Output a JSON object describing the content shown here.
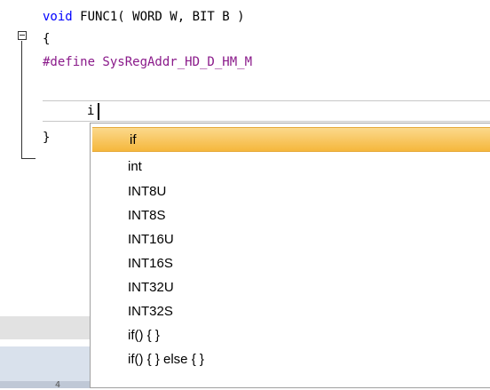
{
  "code": {
    "line1": {
      "kw": "void",
      "rest": " FUNC1( WORD W, BIT B )"
    },
    "line2": "{",
    "line3": "#define SysRegAddr_HD_D_HM_M",
    "typed": "i",
    "line5": "}"
  },
  "autocomplete": {
    "items": [
      {
        "label": "if",
        "selected": true
      },
      {
        "label": "int",
        "selected": false
      },
      {
        "label": "INT8U",
        "selected": false
      },
      {
        "label": "INT8S",
        "selected": false
      },
      {
        "label": "INT16U",
        "selected": false
      },
      {
        "label": "INT16S",
        "selected": false
      },
      {
        "label": "INT32U",
        "selected": false
      },
      {
        "label": "INT32S",
        "selected": false
      },
      {
        "label": "if() { }",
        "selected": false
      },
      {
        "label": "if() { } else { }",
        "selected": false
      }
    ]
  },
  "background_text": "4",
  "colors": {
    "keyword": "#0000ff",
    "preprocessor": "#8a1a8a",
    "selection": "#f5b73c"
  }
}
